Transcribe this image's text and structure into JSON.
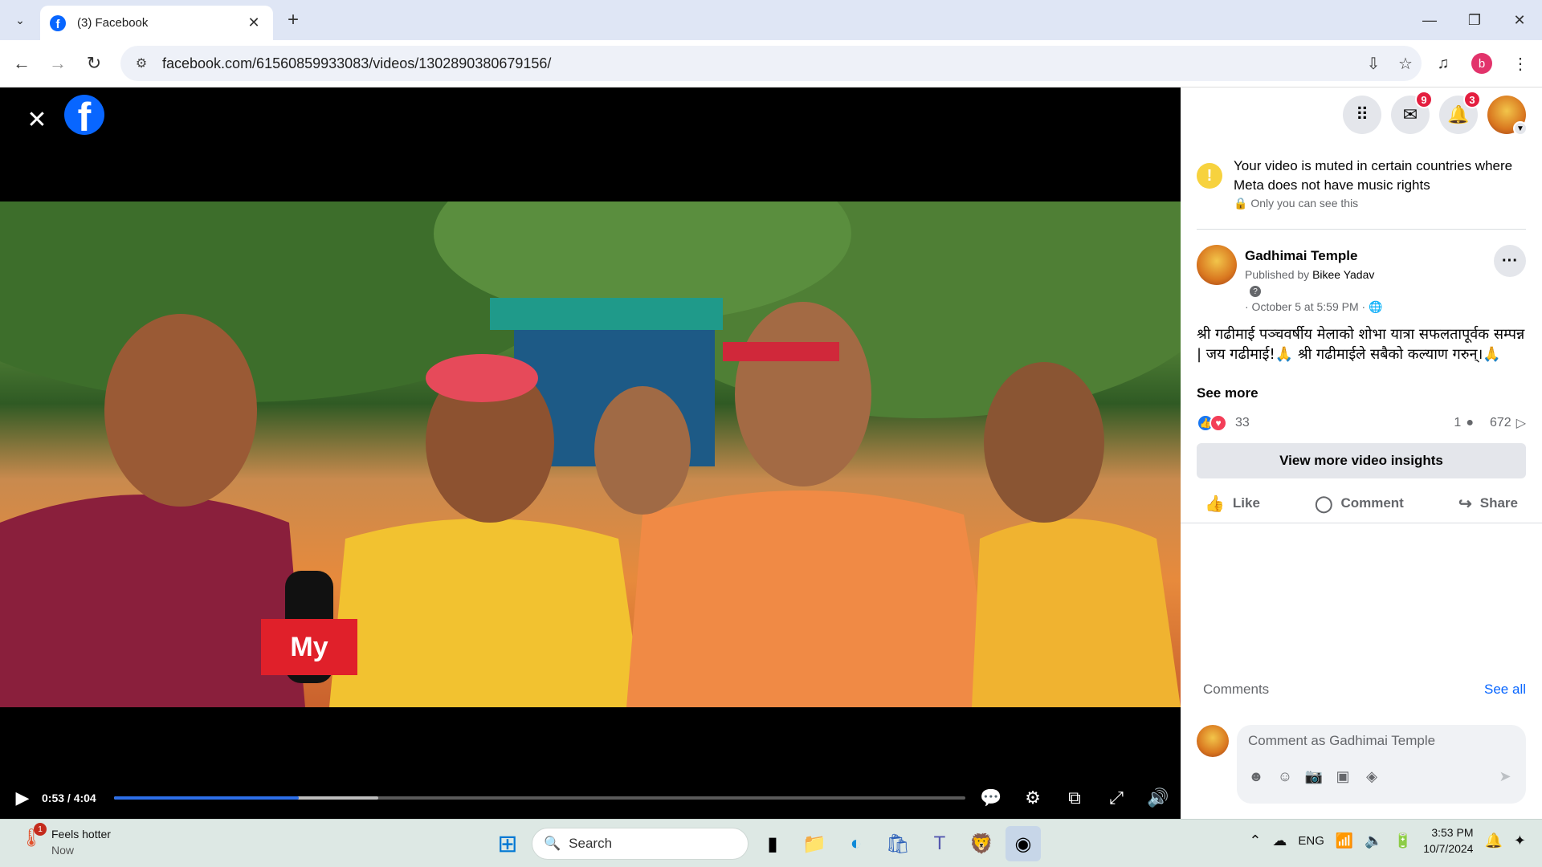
{
  "browser": {
    "tab_title": "(3) Facebook",
    "url": "facebook.com/61560859933083/videos/1302890380679156/",
    "profile_initial": "b"
  },
  "video": {
    "time": "0:53 / 4:04",
    "progress_fraction": 0.217,
    "buffered_fraction": 0.31
  },
  "header": {
    "messenger_badge": "9",
    "notifications_badge": "3"
  },
  "notice": {
    "message": "Your video is muted in certain countries where Meta does not have music rights",
    "visibility": "Only you can see this"
  },
  "post": {
    "page_name": "Gadhimai Temple",
    "published_prefix": "Published by",
    "publisher": "Bikee Yadav",
    "date": "· October 5 at 5:59 PM ·",
    "text": "श्री गढीमाई पञ्चवर्षीय मेलाको शोभा यात्रा सफलतापूर्वक सम्पन्न | जय गढीमाई!🙏 श्री गढीमाईले सबैको कल्याण गरुन्।🙏",
    "see_more": "See more",
    "reaction_count": "33",
    "comment_count": "1",
    "share_count": "672",
    "insights_button": "View more video insights",
    "like_label": "Like",
    "comment_label": "Comment",
    "share_label": "Share"
  },
  "comments": {
    "heading": "Comments",
    "see_all": "See all",
    "placeholder": "Comment as Gadhimai Temple"
  },
  "taskbar": {
    "weather_title": "Feels hotter",
    "weather_sub": "Now",
    "weather_badge": "1",
    "search_label": "Search",
    "lang": "ENG",
    "time": "3:53 PM",
    "date": "10/7/2024"
  }
}
